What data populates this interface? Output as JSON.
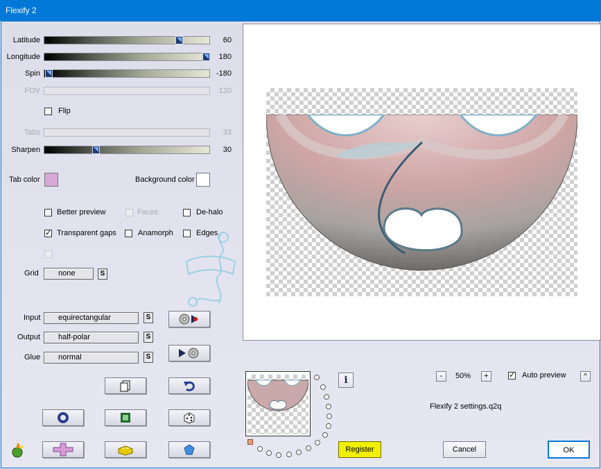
{
  "window": {
    "title": "Flexify 2"
  },
  "sliders": [
    {
      "label": "Latitude",
      "value": "60",
      "enabled": true,
      "fraction": 0.83
    },
    {
      "label": "Longitude",
      "value": "180",
      "enabled": true,
      "fraction": 1.0
    },
    {
      "label": "Spin",
      "value": "-180",
      "enabled": true,
      "fraction": 0.0
    },
    {
      "label": "FOV",
      "value": "120",
      "enabled": false,
      "fraction": null
    },
    {
      "label": "Tabs",
      "value": "33",
      "enabled": false,
      "fraction": null
    },
    {
      "label": "Sharpen",
      "value": "30",
      "enabled": true,
      "fraction": 0.3
    }
  ],
  "flip": {
    "label": "Flip",
    "checked": false
  },
  "colors": {
    "tab_label": "Tab color",
    "tab_color": "#d8a8d8",
    "bg_label": "Background color",
    "bg_color": "#ffffff"
  },
  "options": {
    "better_preview": {
      "label": "Better preview",
      "checked": false
    },
    "faces": {
      "label": "Faces",
      "checked": false,
      "enabled": false
    },
    "de_halo": {
      "label": "De-halo",
      "checked": false
    },
    "transparent_gaps": {
      "label": "Transparent gaps",
      "checked": true,
      "mark": "✓"
    },
    "anamorph": {
      "label": "Anamorph",
      "checked": false
    },
    "edges": {
      "label": "Edges",
      "checked": false
    }
  },
  "grid": {
    "label": "Grid",
    "value": "none"
  },
  "projection": {
    "input": {
      "label": "Input",
      "value": "equirectangular"
    },
    "output": {
      "label": "Output",
      "value": "half-polar"
    },
    "glue": {
      "label": "Glue",
      "value": "normal"
    },
    "s_label": "S"
  },
  "zoom": {
    "minus": "-",
    "value": "50%",
    "plus": "+"
  },
  "auto_preview": {
    "label": "Auto preview",
    "checked": true,
    "mark": "✓",
    "button": "^"
  },
  "settings_file": "Flexify 2 settings.q2q",
  "buttons": {
    "register": "Register",
    "cancel": "Cancel",
    "ok": "OK",
    "info": "i"
  },
  "accent": {
    "register_bg": "#f0f000",
    "titlebar": "#0078d7",
    "ok_border": "#0078d7"
  }
}
